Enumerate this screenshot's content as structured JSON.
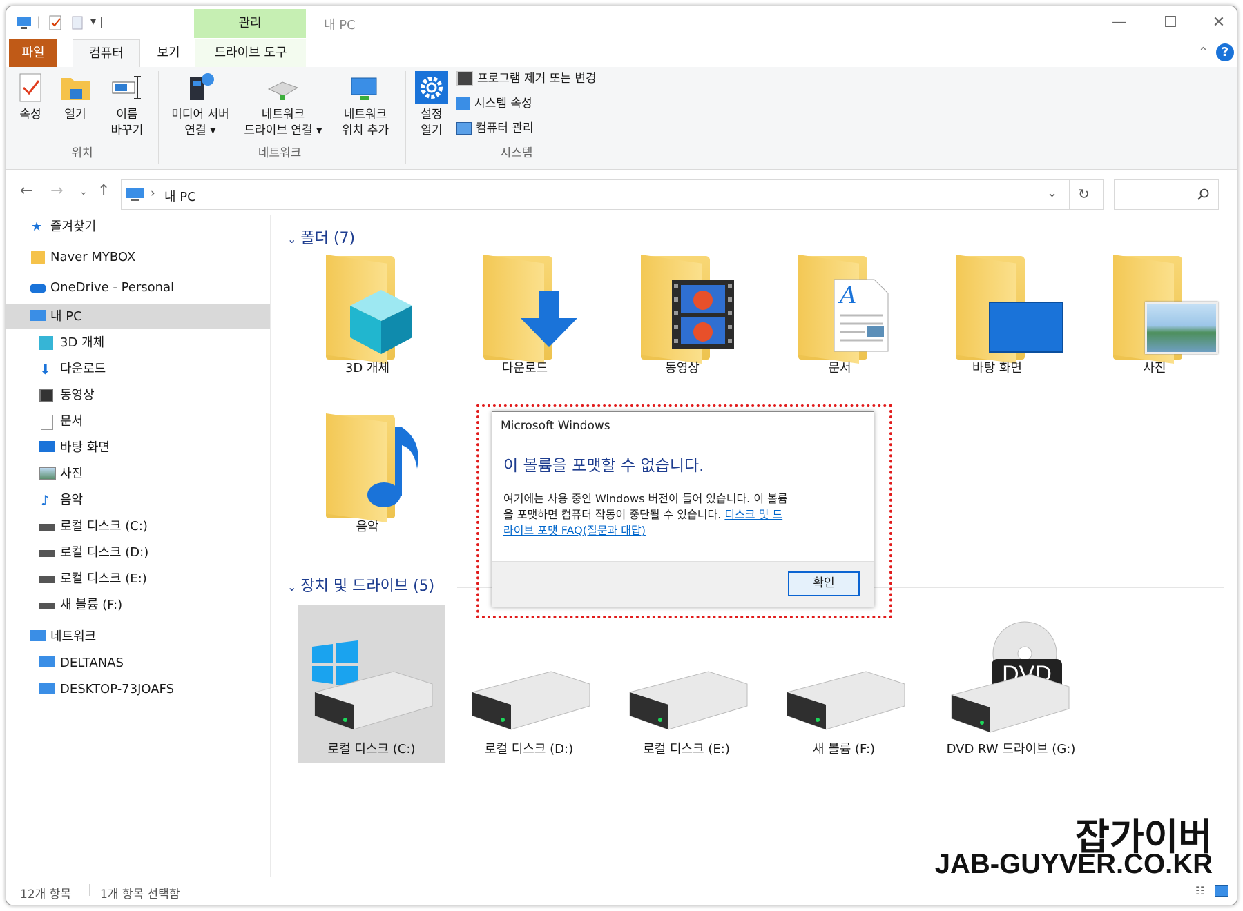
{
  "titlebar": {
    "context_tab": "관리",
    "window_title": "내 PC",
    "controls": {
      "minimize": "—",
      "maximize": "☐",
      "close": "✕"
    }
  },
  "ribbon_tabs": {
    "file": "파일",
    "computer": "컴퓨터",
    "view": "보기",
    "drive_tools": "드라이브 도구"
  },
  "ribbon": {
    "location": {
      "label": "위치",
      "properties": "속성",
      "open": "열기",
      "rename_1": "이름",
      "rename_2": "바꾸기"
    },
    "network": {
      "label": "네트워크",
      "media_1": "미디어 서버",
      "media_2": "연결 ▾",
      "map_1": "네트워크",
      "map_2": "드라이브 연결 ▾",
      "add_1": "네트워크",
      "add_2": "위치 추가"
    },
    "system": {
      "label": "시스템",
      "settings_1": "설정",
      "settings_2": "열기",
      "uninstall": "프로그램 제거 또는 변경",
      "sys_props": "시스템 속성",
      "manage": "컴퓨터 관리"
    }
  },
  "address": {
    "breadcrumb_sep": "›",
    "location": "내 PC"
  },
  "sidebar": {
    "items": [
      {
        "label": "즐겨찾기"
      },
      {
        "label": "Naver MYBOX"
      },
      {
        "label": "OneDrive - Personal"
      },
      {
        "label": "내 PC"
      },
      {
        "label": "3D 개체"
      },
      {
        "label": "다운로드"
      },
      {
        "label": "동영상"
      },
      {
        "label": "문서"
      },
      {
        "label": "바탕 화면"
      },
      {
        "label": "사진"
      },
      {
        "label": "음악"
      },
      {
        "label": "로컬 디스크 (C:)"
      },
      {
        "label": "로컬 디스크 (D:)"
      },
      {
        "label": "로컬 디스크 (E:)"
      },
      {
        "label": "새 볼륨 (F:)"
      },
      {
        "label": "네트워크"
      },
      {
        "label": "DELTANAS"
      },
      {
        "label": "DESKTOP-73JOAFS"
      }
    ]
  },
  "folders": {
    "header": "폴더 (7)",
    "items": [
      "3D 개체",
      "다운로드",
      "동영상",
      "문서",
      "바탕 화면",
      "사진",
      "음악"
    ]
  },
  "drives": {
    "header": "장치 및 드라이브 (5)",
    "items": [
      "로컬 디스크 (C:)",
      "로컬 디스크 (D:)",
      "로컬 디스크 (E:)",
      "새 볼륨 (F:)",
      "DVD RW 드라이브 (G:)"
    ],
    "dvd_badge": "DVD"
  },
  "dialog": {
    "title": "Microsoft Windows",
    "heading": "이 볼륨을 포맷할 수 없습니다.",
    "body_1": "여기에는 사용 중인 Windows 버전이 들어 있습니다. 이 볼륨",
    "body_2_text": "을 포맷하면 컴퓨터 작동이 중단될 수 있습니다.",
    "body_2_link": "디스크 및 드",
    "body_3_link": "라이브 포맷 FAQ(질문과 대답)",
    "ok": "확인"
  },
  "status": {
    "count": "12개 항목",
    "selected": "1개 항목 선택함"
  },
  "watermark": {
    "line1": "잡가이버",
    "line2": "JAB-GUYVER.CO.KR"
  },
  "colors": {
    "file_tab": "#c05a17",
    "context_tab": "#c6efb3",
    "heading_blue": "#1e3d8f",
    "link_blue": "#0066cc",
    "highlight": "#e11b1b"
  }
}
